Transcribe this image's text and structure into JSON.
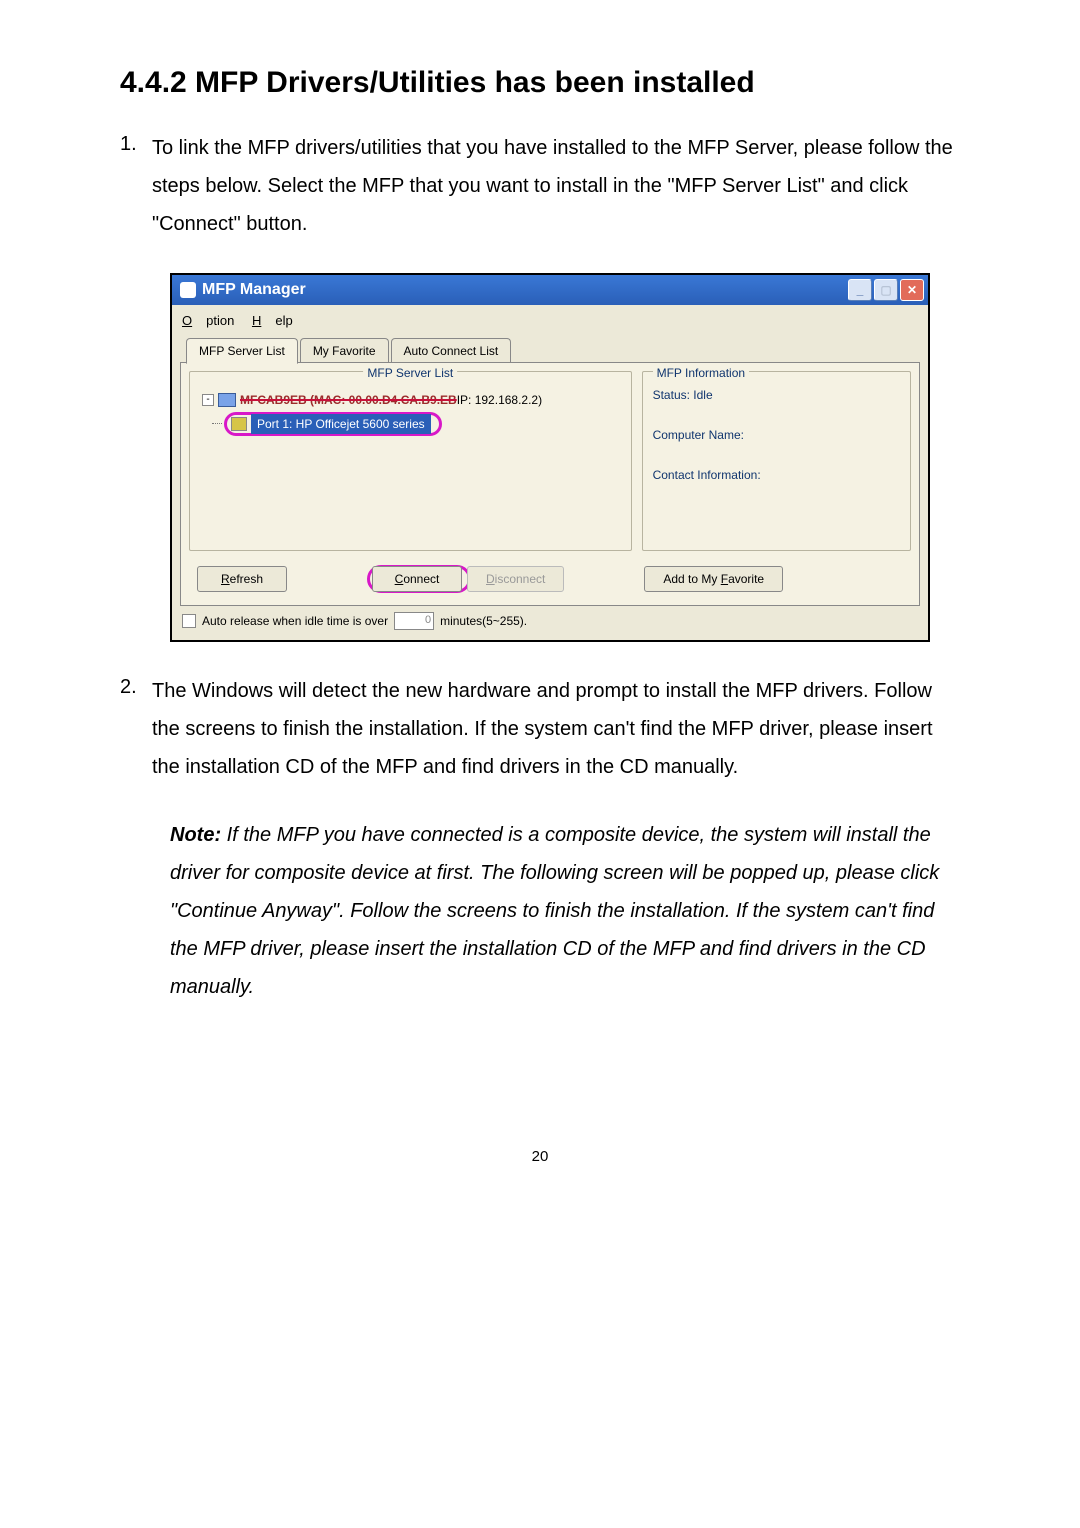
{
  "heading": "4.4.2    MFP Drivers/Utilities has been installed",
  "list": {
    "item1": {
      "num": "1.",
      "text": "To link the MFP drivers/utilities that you have installed to the MFP Server, please follow the steps below. Select the MFP that you want to install in the \"MFP Server List\" and click \"Connect\" button."
    },
    "item2": {
      "num": "2.",
      "text": "The Windows will detect the new hardware and prompt to install the MFP drivers. Follow the screens to finish the installation. If the system can't find the MFP driver, please insert the installation CD of the MFP and find drivers in the CD manually."
    }
  },
  "note": {
    "label": "Note:",
    "text": " If the MFP you have connected is a composite device, the system will install the driver for composite device at first. The following screen will be popped up, please click \"Continue Anyway\". Follow the screens to finish the installation. If the system can't find the MFP driver, please insert the installation CD of the MFP and find drivers in the CD manually."
  },
  "dialog": {
    "title": "MFP Manager",
    "menu": {
      "option": "Option",
      "help": "Help",
      "option_u": "O",
      "help_u": "H"
    },
    "tabs": {
      "t1": "MFP Server List",
      "t2": "My Favorite",
      "t3": "Auto Connect List"
    },
    "serverListLabel": "MFP Server List",
    "tree": {
      "root_red": "MFCAB9EB (MAC: 00.00.D4.CA.B9.EB",
      "root_ip": "  IP: 192.168.2.2)",
      "port": "Port 1: HP Officejet 5600 series"
    },
    "infoLabel": "MFP Information",
    "info": {
      "status": "Status: Idle",
      "comp": "Computer Name:",
      "contact": "Contact Information:"
    },
    "buttons": {
      "refresh": "Refresh",
      "connect": "Connect",
      "disconnect": "Disconnect",
      "fav": "Add to My Favorite",
      "refresh_u": "R",
      "connect_u": "C",
      "disconnect_u": "D",
      "fav_u": "F"
    },
    "autorelease": {
      "label": "Auto release when idle time is over",
      "value": "0",
      "suffix": "minutes(5~255)."
    }
  },
  "pageNumber": "20"
}
